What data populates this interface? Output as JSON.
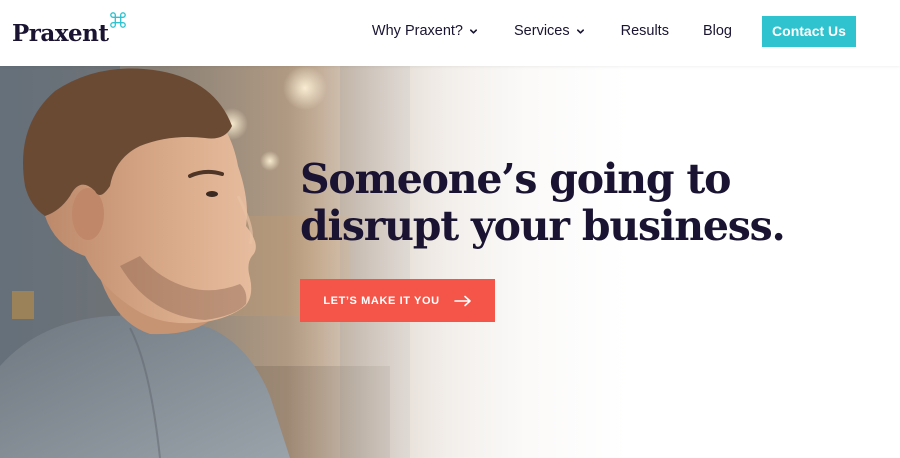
{
  "header": {
    "logo_text": "Praxent",
    "nav": [
      {
        "label": "Why Praxent?",
        "dropdown": true
      },
      {
        "label": "Services",
        "dropdown": true
      },
      {
        "label": "Results",
        "dropdown": false
      },
      {
        "label": "Blog",
        "dropdown": false
      }
    ],
    "contact_label": "Contact Us"
  },
  "hero": {
    "headline_line1": "Someone’s going to",
    "headline_line2": "disrupt your business.",
    "cta_label": "LET’S MAKE IT YOU",
    "cta_icon": "arrow-right-icon"
  },
  "colors": {
    "brand_navy": "#1a1432",
    "accent_teal": "#2fc3cf",
    "cta_coral": "#f55548"
  }
}
